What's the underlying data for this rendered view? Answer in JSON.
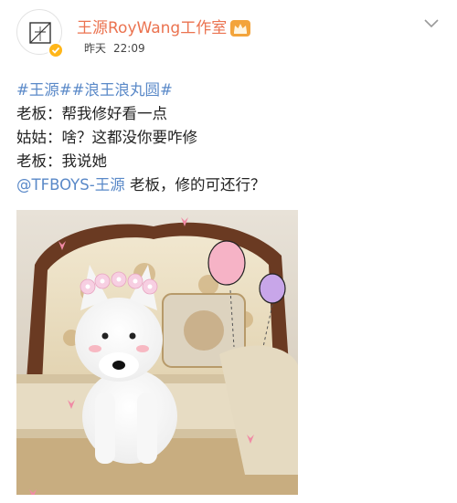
{
  "post": {
    "author_name": "王源RoyWang工作室",
    "time_relative": "昨天",
    "time_clock": "22:09",
    "tags": [
      "#王源#",
      "#浪王浪丸圆#"
    ],
    "lines": [
      "老板：帮我修好看一点",
      "姑姑：啥？这都没你要咋修",
      "老板：我说她"
    ],
    "mention": "@TFBOYS-王源",
    "mention_tail": " 老板，修的可还行？"
  },
  "colors": {
    "name": "#eb7350",
    "link": "#5a89c8",
    "verified": "#ffb619"
  },
  "icons": {
    "avatar": "studio-logo",
    "verified": "verified-badge-icon",
    "crown": "crown-icon",
    "menu": "chevron-down-icon"
  }
}
